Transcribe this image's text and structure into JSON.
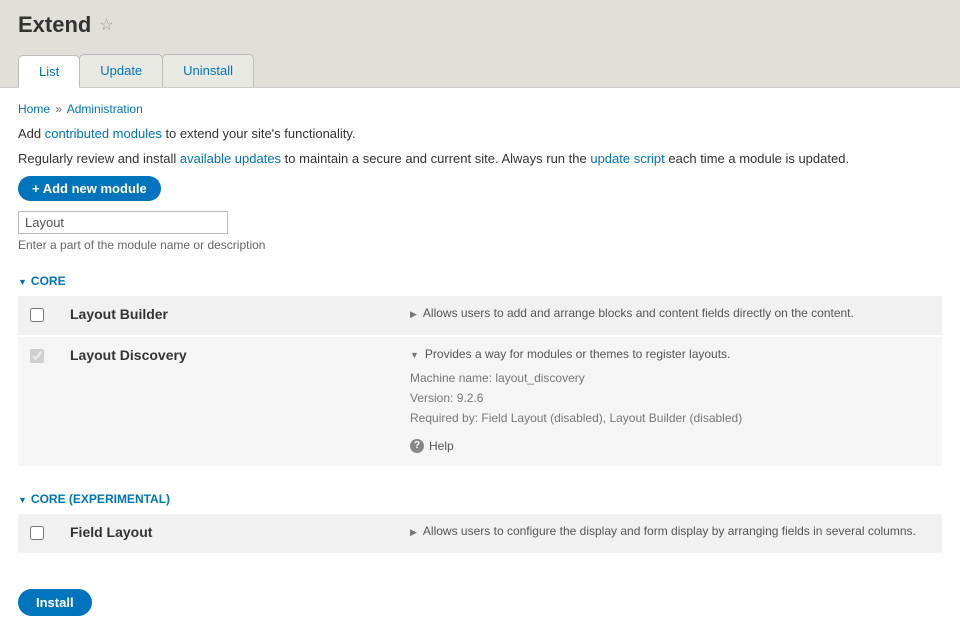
{
  "page": {
    "title": "Extend"
  },
  "tabs": {
    "list": "List",
    "update": "Update",
    "uninstall": "Uninstall"
  },
  "breadcrumb": {
    "home": "Home",
    "sep": "»",
    "admin": "Administration"
  },
  "intro": {
    "line1_pre": "Add ",
    "line1_link": "contributed modules",
    "line1_post": " to extend your site's functionality.",
    "line2_pre": "Regularly review and install ",
    "line2_link1": "available updates",
    "line2_mid": " to maintain a secure and current site. Always run the ",
    "line2_link2": "update script",
    "line2_post": " each time a module is updated."
  },
  "add_button": "+ Add new module",
  "filter": {
    "value": "Layout",
    "hint": "Enter a part of the module name or description"
  },
  "groups": {
    "core": "CORE",
    "core_exp": "CORE (EXPERIMENTAL)"
  },
  "modules": {
    "layout_builder": {
      "name": "Layout Builder",
      "desc": "Allows users to add and arrange blocks and content fields directly on the content."
    },
    "layout_discovery": {
      "name": "Layout Discovery",
      "desc": "Provides a way for modules or themes to register layouts.",
      "machine_label": "Machine name: ",
      "machine": "layout_discovery",
      "version_label": "Version: ",
      "version": "9.2.6",
      "required_label": "Required by: ",
      "required": "Field Layout (disabled), Layout Builder (disabled)",
      "help": "Help"
    },
    "field_layout": {
      "name": "Field Layout",
      "desc": "Allows users to configure the display and form display by arranging fields in several columns."
    }
  },
  "install_button": "Install"
}
